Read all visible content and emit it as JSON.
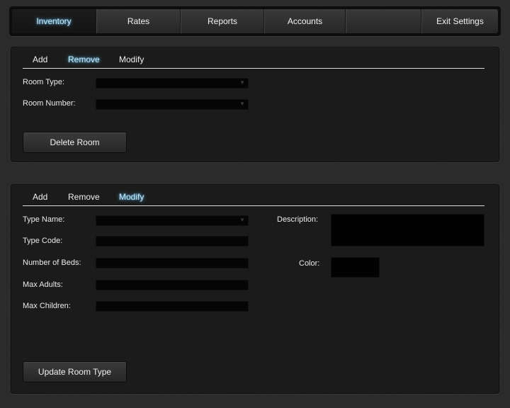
{
  "nav": {
    "items": [
      {
        "label": "Inventory",
        "active": true
      },
      {
        "label": "Rates",
        "active": false
      },
      {
        "label": "Reports",
        "active": false
      },
      {
        "label": "Accounts",
        "active": false
      },
      {
        "label": "",
        "active": false
      },
      {
        "label": "Exit Settings",
        "active": false
      }
    ]
  },
  "room_panel": {
    "tabs": [
      {
        "label": "Add",
        "active": false
      },
      {
        "label": "Remove",
        "active": true
      },
      {
        "label": "Modify",
        "active": false
      }
    ],
    "fields": {
      "room_type_label": "Room Type:",
      "room_type_value": "",
      "room_number_label": "Room Number:",
      "room_number_value": ""
    },
    "delete_button": "Delete Room"
  },
  "type_panel": {
    "tabs": [
      {
        "label": "Add",
        "active": false
      },
      {
        "label": "Remove",
        "active": false
      },
      {
        "label": "Modify",
        "active": true
      }
    ],
    "fields": {
      "type_name_label": "Type Name:",
      "type_name_value": "",
      "type_code_label": "Type Code:",
      "type_code_value": "",
      "beds_label": "Number of Beds:",
      "beds_value": "",
      "max_adults_label": "Max Adults:",
      "max_adults_value": "",
      "max_children_label": "Max Children:",
      "max_children_value": "",
      "description_label": "Description:",
      "description_value": "",
      "color_label": "Color:",
      "color_value": "#020202"
    },
    "update_button": "Update Room Type"
  },
  "colors": {
    "accent_glow": "#58b8e8",
    "panel_bg": "#1b1b1b",
    "field_bg": "#050505"
  },
  "icons": {
    "dropdown": "chevron-down-icon"
  }
}
